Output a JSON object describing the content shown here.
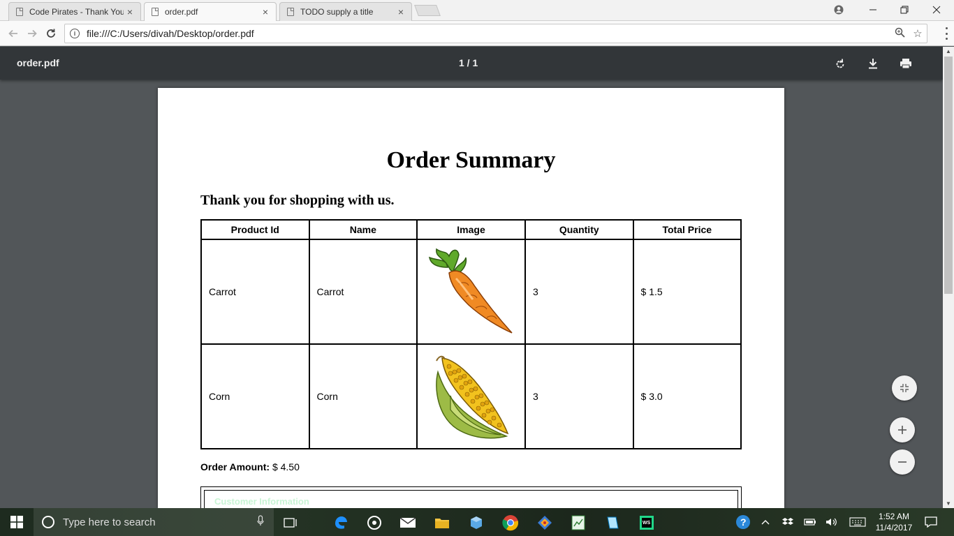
{
  "browser": {
    "tabs": [
      {
        "title": "Code Pirates - Thank You",
        "close": "×"
      },
      {
        "title": "order.pdf",
        "close": "×"
      },
      {
        "title": "TODO supply a title",
        "close": "×"
      }
    ],
    "url": "file:///C:/Users/divah/Desktop/order.pdf"
  },
  "viewer": {
    "filename": "order.pdf",
    "page_indicator": "1  /  1"
  },
  "document": {
    "title": "Order Summary",
    "subtitle": "Thank you for shopping with us.",
    "table": {
      "headers": [
        "Product Id",
        "Name",
        "Image",
        "Quantity",
        "Total Price"
      ],
      "rows": [
        {
          "product_id": "Carrot",
          "name": "Carrot",
          "image": "carrot-image",
          "quantity": "3",
          "total_price": "$ 1.5"
        },
        {
          "product_id": "Corn",
          "name": "Corn",
          "image": "corn-image",
          "quantity": "3",
          "total_price": "$ 3.0"
        }
      ]
    },
    "order_amount_label": "Order Amount:",
    "order_amount_value": "$ 4.50",
    "customer_section_label": "Customer Information"
  },
  "taskbar": {
    "search_placeholder": "Type here to search",
    "time": "1:52 AM",
    "date": "11/4/2017"
  },
  "colors": {
    "pdf_toolbar": "#323639",
    "viewer_background": "#525659",
    "customer_label": "#c9f5d5"
  }
}
